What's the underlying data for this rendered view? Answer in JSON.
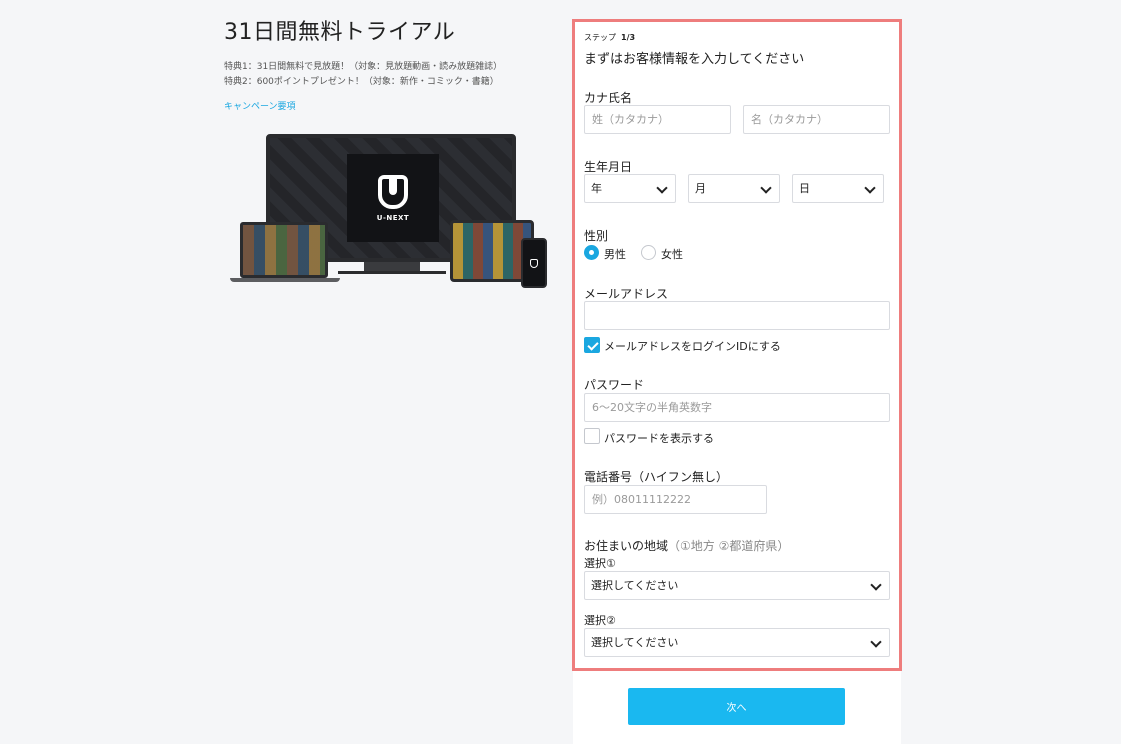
{
  "left": {
    "title": "31日間無料トライアル",
    "benefit1": "特典1：31日間無料で見放題！（対象：見放題動画・読み放題雑誌）",
    "benefit2": "特典2：600ポイントプレゼント！（対象：新作・コミック・書籍）",
    "campaign_link": "キャンペーン要項",
    "logo_word": "U-NEXT"
  },
  "form": {
    "step_label": "ステップ",
    "step_value": "1/3",
    "title": "まずはお客様情報を入力してください",
    "kana": {
      "label": "カナ氏名",
      "last_placeholder": "姓（カタカナ）",
      "first_placeholder": "名（カタカナ）"
    },
    "birth": {
      "label": "生年月日",
      "year": "年",
      "month": "月",
      "day": "日"
    },
    "gender": {
      "label": "性別",
      "male": "男性",
      "female": "女性",
      "selected": "male"
    },
    "email": {
      "label": "メールアドレス",
      "value": "",
      "use_as_login_label": "メールアドレスをログインIDにする",
      "use_as_login_checked": true
    },
    "password": {
      "label": "パスワード",
      "placeholder": "6〜20文字の半角英数字",
      "show_label": "パスワードを表示する",
      "show_checked": false
    },
    "phone": {
      "label": "電話番号（ハイフン無し）",
      "placeholder": "例）08011112222"
    },
    "region": {
      "label": "お住まいの地域",
      "hint": "（①地方 ②都道府県）",
      "select1_label": "選択①",
      "select1_value": "選択してください",
      "select2_label": "選択②",
      "select2_value": "選択してください"
    }
  },
  "footer": {
    "next_label": "次へ"
  },
  "colors": {
    "accent": "#1aa7e0",
    "button": "#1ab8f0",
    "panel_border": "#ee7d7d"
  }
}
